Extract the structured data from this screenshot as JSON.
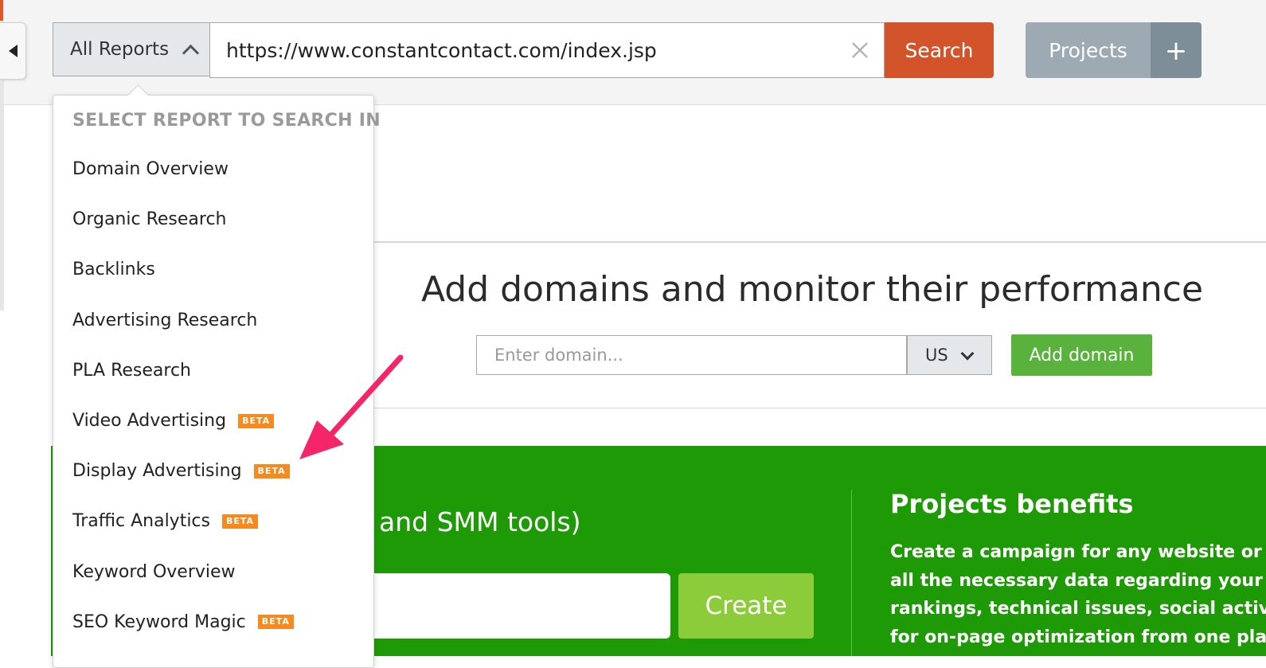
{
  "colors": {
    "search_button": "#d3542b",
    "projects_button": "#9daab3",
    "projects_plus": "#7e8e98",
    "add_domain_button": "#58b23c",
    "green_panel": "#1f9a07",
    "create_button": "#8ccc3b",
    "beta_badge": "#f68a1f",
    "annotation_arrow": "#f5256a"
  },
  "toolbar": {
    "report_selector": {
      "label": "All Reports",
      "icon": "chevron-up-icon"
    },
    "url_value": "https://www.constantcontact.com/index.jsp",
    "clear_icon": "close-icon",
    "search_label": "Search",
    "projects_label": "Projects",
    "add_project_label": "+"
  },
  "dropdown": {
    "heading": "SELECT REPORT TO SEARCH IN",
    "items": [
      {
        "label": "Domain Overview",
        "badge": ""
      },
      {
        "label": "Organic Research",
        "badge": ""
      },
      {
        "label": "Backlinks",
        "badge": ""
      },
      {
        "label": "Advertising Research",
        "badge": ""
      },
      {
        "label": "PLA Research",
        "badge": ""
      },
      {
        "label": "Video Advertising",
        "badge": "BETA"
      },
      {
        "label": "Display Advertising",
        "badge": "BETA"
      },
      {
        "label": "Traffic Analytics",
        "badge": "BETA"
      },
      {
        "label": "Keyword Overview",
        "badge": ""
      },
      {
        "label": "SEO Keyword Magic",
        "badge": "BETA"
      }
    ]
  },
  "monitor": {
    "title": "Add domains and monitor their performance",
    "domain_placeholder": "Enter domain...",
    "country": "US",
    "add_label": "Add domain"
  },
  "projects_panel": {
    "subtitle_fragment": "and SMM tools)",
    "create_label": "Create",
    "benefits_title": "Projects benefits",
    "benefits_lines": [
      "Create a campaign for any website or social",
      "all the necessary data regarding your domain",
      "rankings, technical issues, social activity, and",
      "for on-page optimization from one place."
    ]
  }
}
